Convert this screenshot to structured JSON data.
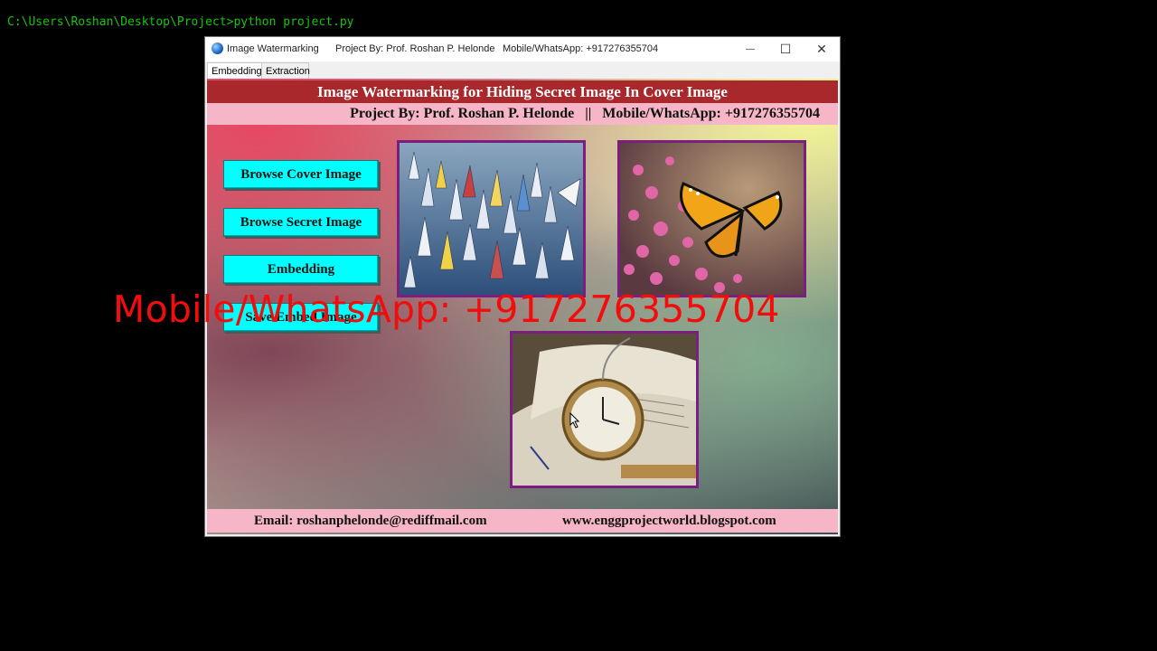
{
  "terminal": {
    "command_line": "C:\\Users\\Roshan\\Desktop\\Project>python project.py"
  },
  "window": {
    "title": "Image Watermarking",
    "project_by": "Project By: Prof. Roshan P. Helonde",
    "contact": "Mobile/WhatsApp: +917276355704",
    "controls": {
      "minimize": "—",
      "maximize": "☐",
      "close": "✕"
    }
  },
  "tabs": [
    {
      "label": "Embedding",
      "active": true
    },
    {
      "label": "Extraction",
      "active": false
    }
  ],
  "banner": {
    "title": "Image Watermarking for Hiding Secret Image In Cover Image",
    "subtitle": "Project By: Prof. Roshan P. Helonde   ||   Mobile/WhatsApp: +917276355704"
  },
  "buttons": {
    "browse_cover": "Browse Cover Image",
    "browse_secret": "Browse Secret Image",
    "embedding": "Embedding",
    "save_embed": "Save Embed Image"
  },
  "images": {
    "cover": "sailboats-regatta",
    "secret": "monarch-butterfly-on-pink-flowers",
    "embedded": "pocket-watch-on-book"
  },
  "footer": {
    "email": "Email: roshanphelonde@rediffmail.com",
    "website": "www.enggprojectworld.blogspot.com"
  },
  "overlay": {
    "text": "Mobile/WhatsApp: +917276355704"
  },
  "colors": {
    "banner_bg": "#a8282c",
    "subbanner_bg": "#f6b6c7",
    "button_bg": "#00ffff",
    "frame_border": "#7a1e80",
    "overlay_text": "#f20d0d",
    "terminal_text": "#16c60c"
  }
}
